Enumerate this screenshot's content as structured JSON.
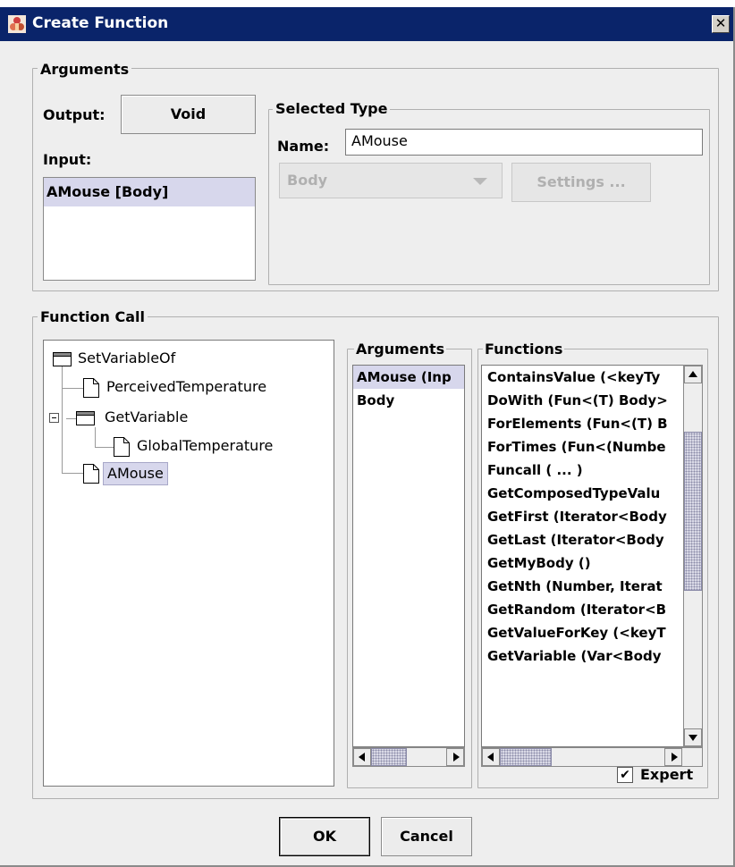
{
  "window": {
    "title": "Create Function",
    "close_symbol": "✕"
  },
  "arguments_group": {
    "legend": "Arguments",
    "output_label": "Output:",
    "output_value": "Void",
    "input_label": "Input:",
    "input_items": [
      "AMouse [Body]"
    ]
  },
  "selected_type": {
    "legend": "Selected Type",
    "name_label": "Name:",
    "name_value": "AMouse",
    "type_combo": "Body",
    "settings_button": "Settings ..."
  },
  "function_call": {
    "legend": "Function Call",
    "tree": [
      {
        "label": "SetVariableOf",
        "type": "folder",
        "level": 0,
        "expander": ""
      },
      {
        "label": "PerceivedTemperature",
        "type": "file",
        "level": 1,
        "expander": ""
      },
      {
        "label": "GetVariable",
        "type": "folder",
        "level": 1,
        "expander": "⊟"
      },
      {
        "label": "GlobalTemperature",
        "type": "file",
        "level": 2,
        "expander": ""
      },
      {
        "label": "AMouse",
        "type": "file",
        "level": 1,
        "expander": "",
        "selected": true
      }
    ],
    "arguments_legend": "Arguments",
    "arguments_items": [
      "AMouse (Inp",
      "Body"
    ],
    "functions_legend": "Functions",
    "functions_items": [
      "ContainsValue (<keyTy",
      "DoWith (Fun<(T) Body>",
      "ForElements (Fun<(T) B",
      "ForTimes (Fun<(Numbe",
      "Funcall ( ... )",
      "GetComposedTypeValu",
      "GetFirst (Iterator<Body",
      "GetLast (Iterator<Body",
      "GetMyBody  ()",
      "GetNth (Number, Iterat",
      "GetRandom (Iterator<B",
      "GetValueForKey (<keyT",
      "GetVariable (Var<Body"
    ],
    "expert_checkbox": {
      "label": "Expert",
      "checked": true,
      "check_symbol": "✔"
    }
  },
  "buttons": {
    "ok": "OK",
    "cancel": "Cancel"
  },
  "colors": {
    "titlebar": "#0a246a",
    "selection": "#d7d7ec",
    "background": "#eeeeee"
  }
}
